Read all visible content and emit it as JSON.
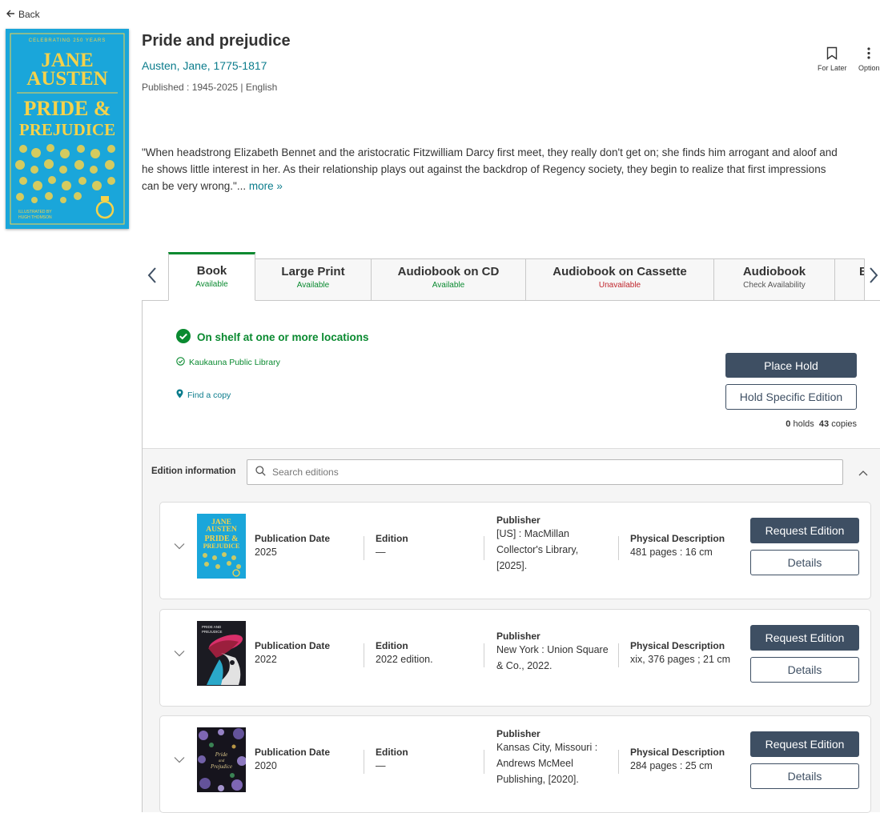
{
  "nav": {
    "back_label": "Back"
  },
  "book": {
    "title": "Pride and prejudice",
    "author": "Austen, Jane, 1775-1817",
    "published": "Published : 1945-2025 | English",
    "cover": {
      "top_banner": "CELEBRATING 250 YEARS",
      "line1": "JANE",
      "line2": "AUSTEN",
      "line3": "PRIDE &",
      "line4": "PREJUDICE",
      "illustrated": "ILLUSTRATED BY",
      "illustrator": "HUGH THOMSON"
    },
    "summary": "\"When headstrong Elizabeth Bennet and the aristocratic Fitzwilliam Darcy first meet, they really don't get on; she finds him arrogant and aloof and he shows little interest in her. As their relationship plays out against the backdrop of Regency society, they begin to realize that first impressions can be very wrong.\"...",
    "more_label": "more »"
  },
  "actions": {
    "for_later": "For Later",
    "options": "Option"
  },
  "tabs": [
    {
      "name": "Book",
      "status": "Available"
    },
    {
      "name": "Large Print",
      "status": "Available"
    },
    {
      "name": "Audiobook on CD",
      "status": "Available"
    },
    {
      "name": "Audiobook on Cassette",
      "status": "Unavailable"
    },
    {
      "name": "Audiobook",
      "status": "Check Availability"
    },
    {
      "name": "E"
    }
  ],
  "availability": {
    "headline": "On shelf at one or more locations",
    "location": "Kaukauna Public Library",
    "find_copy": "Find a copy",
    "place_hold": "Place Hold",
    "hold_specific": "Hold Specific Edition",
    "holds_count": "0",
    "holds_label": "holds",
    "copies_count": "43",
    "copies_label": "copies"
  },
  "editions_section": {
    "label": "Edition information",
    "search_placeholder": "Search editions"
  },
  "edition_labels": {
    "pub_date": "Publication Date",
    "edition": "Edition",
    "publisher": "Publisher",
    "physical": "Physical Description",
    "request": "Request Edition",
    "details": "Details"
  },
  "editions": [
    {
      "pub_date": "2025",
      "edition": "—",
      "publisher_lines": [
        "[US] : MacMillan",
        "Collector's Library,",
        "[2025]."
      ],
      "physical": "481 pages : 16 cm",
      "cover_line1": "JANE",
      "cover_line2": "AUSTEN",
      "cover_line3": "PRIDE &",
      "cover_line4": "PREJUDICE"
    },
    {
      "pub_date": "2022",
      "edition": "2022 edition.",
      "publisher_lines": [
        "New York : Union Square",
        "& Co., 2022."
      ],
      "physical": "xix, 376 pages ; 21 cm",
      "cover_line1": "PRIDE AND",
      "cover_line2": "PREJUDICE"
    },
    {
      "pub_date": "2020",
      "edition": "—",
      "publisher_lines": [
        "Kansas City, Missouri :",
        "Andrews McMeel",
        "Publishing, [2020]."
      ],
      "physical": "284 pages : 25 cm",
      "cover_line1": "Pride",
      "cover_line2": "and",
      "cover_line3": "Prejudice"
    }
  ],
  "colors": {
    "primary_button": "#3e4f63",
    "available": "#0a8a30",
    "unavailable": "#c0262d",
    "link": "#0b7c8c",
    "cover_blue": "#1aa6da",
    "cover_yellow": "#f5d24a"
  }
}
